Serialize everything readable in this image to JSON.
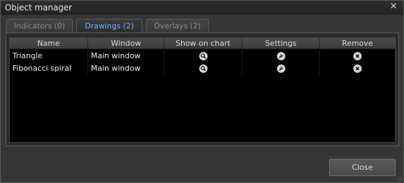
{
  "window": {
    "title": "Object manager",
    "close_glyph": "✕"
  },
  "tabs": [
    {
      "label": "Indicators (0)",
      "active": false
    },
    {
      "label": "Drawings (2)",
      "active": true
    },
    {
      "label": "Overlays (2)",
      "active": false
    }
  ],
  "table": {
    "columns": [
      "Name",
      "Window",
      "Show on chart",
      "Settings",
      "Remove"
    ],
    "rows": [
      {
        "name": "Triangle",
        "window": "Main window",
        "show_icon": "magnifier-icon",
        "settings_icon": "wrench-icon",
        "remove_icon": "remove-x-icon"
      },
      {
        "name": "Fibonacci spiral",
        "window": "Main window",
        "show_icon": "magnifier-icon",
        "settings_icon": "wrench-icon",
        "remove_icon": "remove-x-icon"
      }
    ]
  },
  "footer": {
    "close_label": "Close"
  },
  "colors": {
    "active_tab": "#6ab0ff",
    "grid_bg": "#000000",
    "dialog_bg": "#363636"
  }
}
